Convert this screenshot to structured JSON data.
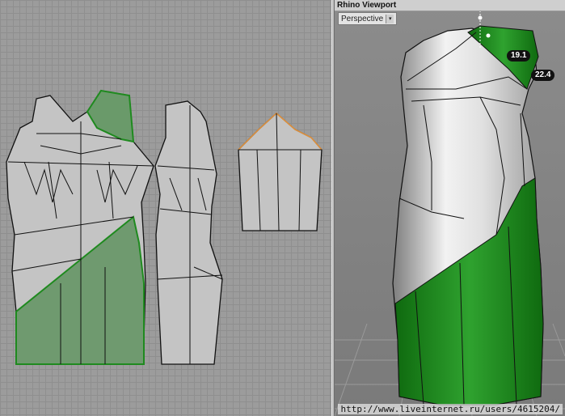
{
  "viewport": {
    "title": "Rhino Viewport",
    "view_mode": "Perspective",
    "dropdown_glyph": "▾"
  },
  "dimensions": [
    {
      "value": "19.1"
    },
    {
      "value": "22.4"
    }
  ],
  "watermark": "http://www.liveinternet.ru/users/4615204/",
  "colors": {
    "accent_green": "#1f8a1f",
    "pattern_fill": "#c4c4c4",
    "highlight_orange": "#e0903a"
  }
}
